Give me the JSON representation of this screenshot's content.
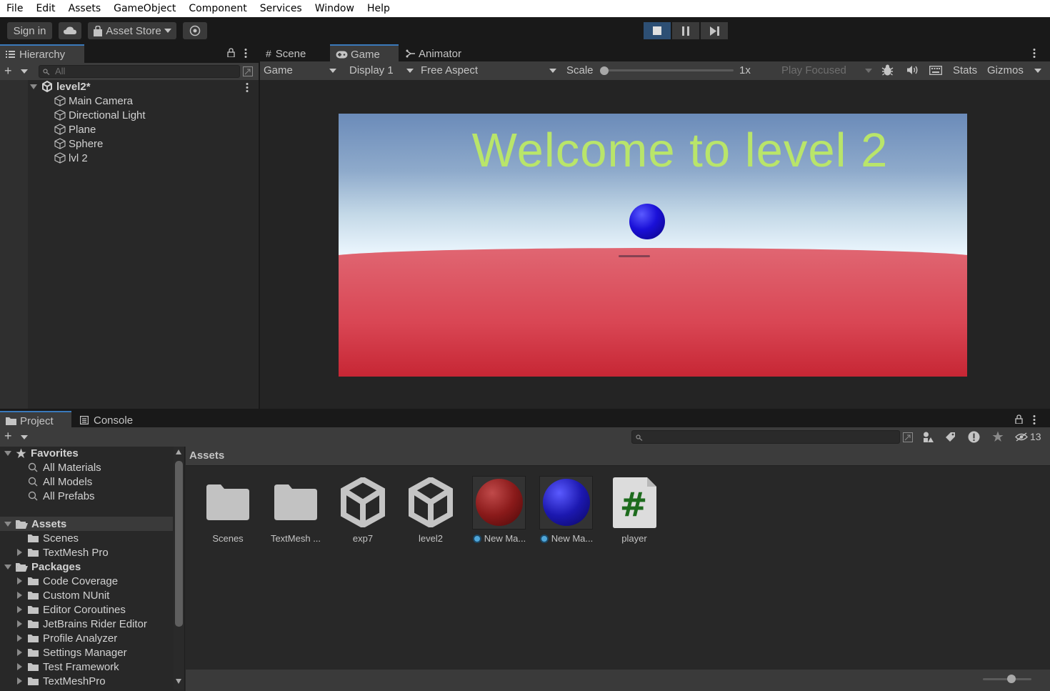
{
  "menu": [
    "File",
    "Edit",
    "Assets",
    "GameObject",
    "Component",
    "Services",
    "Window",
    "Help"
  ],
  "toolbar": {
    "sign_in": "Sign in",
    "asset_store": "Asset Store"
  },
  "hierarchy": {
    "tab": "Hierarchy",
    "search_placeholder": "All",
    "scene": "level2*",
    "items": [
      "Main Camera",
      "Directional Light",
      "Plane",
      "Sphere",
      "lvl 2"
    ]
  },
  "view_tabs": [
    "Scene",
    "Game",
    "Animator"
  ],
  "game_toolbar": {
    "mode": "Game",
    "display": "Display 1",
    "aspect": "Free Aspect",
    "scale_label": "Scale",
    "scale_value": "1x",
    "play_focused": "Play Focused",
    "stats": "Stats",
    "gizmos": "Gizmos"
  },
  "game_view": {
    "welcome_text": "Welcome to level 2",
    "colors": {
      "sky_top": "#6b8bb9",
      "horizon": "#eef8ff",
      "ground": "#e06672",
      "ground_bottom": "#c42230",
      "text": "#b9e56a",
      "ball": "#1a10d8"
    }
  },
  "bottom_tabs": [
    "Project",
    "Console"
  ],
  "project": {
    "hidden_count": "13",
    "favorites_label": "Favorites",
    "favorites": [
      "All Materials",
      "All Models",
      "All Prefabs"
    ],
    "assets_label": "Assets",
    "assets_children": [
      "Scenes",
      "TextMesh Pro"
    ],
    "packages_label": "Packages",
    "packages": [
      "Code Coverage",
      "Custom NUnit",
      "Editor Coroutines",
      "JetBrains Rider Editor",
      "Profile Analyzer",
      "Settings Manager",
      "Test Framework",
      "TextMeshPro"
    ],
    "breadcrumb": "Assets",
    "grid": [
      {
        "label": "Scenes",
        "icon": "folder-icon"
      },
      {
        "label": "TextMesh ...",
        "icon": "folder-icon"
      },
      {
        "label": "exp7",
        "icon": "unity-scene-icon"
      },
      {
        "label": "level2",
        "icon": "unity-scene-icon"
      },
      {
        "label": "New Ma...",
        "icon": "red-material-icon"
      },
      {
        "label": "New Ma...",
        "icon": "blue-material-icon"
      },
      {
        "label": "player",
        "icon": "csharp-script-icon"
      }
    ]
  }
}
